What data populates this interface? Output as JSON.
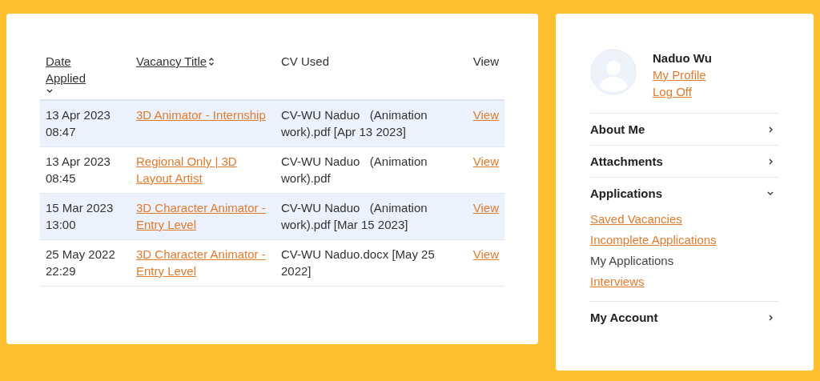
{
  "table": {
    "columns": [
      {
        "label": "Date Applied",
        "sortable": true,
        "sorted": true
      },
      {
        "label": "Vacancy Title",
        "sortable": true,
        "sorted": false
      },
      {
        "label": "CV Used",
        "sortable": false
      },
      {
        "label": "View",
        "sortable": false
      }
    ],
    "rows": [
      {
        "date": "13 Apr 2023 08:47",
        "vacancy": "3D Animator - Internship",
        "cv": "CV-WU Naduo   (Animation work).pdf [Apr 13 2023]",
        "view": "View"
      },
      {
        "date": "13 Apr 2023 08:45",
        "vacancy": "Regional Only | 3D Layout Artist",
        "cv": "CV-WU Naduo   (Animation work).pdf",
        "view": "View"
      },
      {
        "date": "15 Mar 2023 13:00",
        "vacancy": "3D Character Animator - Entry Level",
        "cv": "CV-WU Naduo   (Animation work).pdf [Mar 15 2023]",
        "view": "View"
      },
      {
        "date": "25 May 2022 22:29",
        "vacancy": "3D Character Animator - Entry Level",
        "cv": "CV-WU Naduo.docx [May 25 2022]",
        "view": "View"
      }
    ]
  },
  "sidebar": {
    "user": {
      "name": "Naduo Wu",
      "links": [
        "My Profile",
        "Log Off"
      ]
    },
    "sections": [
      {
        "label": "About Me",
        "expanded": false
      },
      {
        "label": "Attachments",
        "expanded": false
      },
      {
        "label": "Applications",
        "expanded": true,
        "children": [
          {
            "label": "Saved Vacancies",
            "selected": false
          },
          {
            "label": "Incomplete Applications",
            "selected": false
          },
          {
            "label": "My Applications",
            "selected": true
          },
          {
            "label": "Interviews",
            "selected": false
          }
        ]
      },
      {
        "label": "My Account",
        "expanded": false
      }
    ]
  }
}
